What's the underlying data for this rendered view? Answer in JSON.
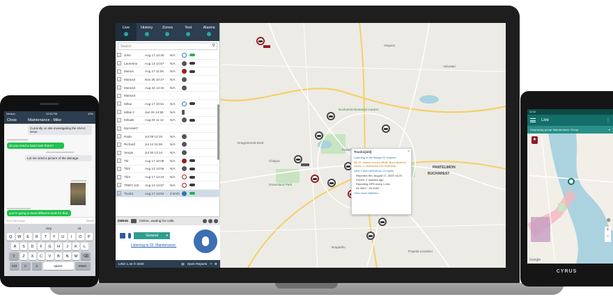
{
  "desktop": {
    "tabs": [
      {
        "label": "Live"
      },
      {
        "label": "History"
      },
      {
        "label": "Zones"
      },
      {
        "label": "Text"
      },
      {
        "label": "Alarms"
      }
    ],
    "search_placeholder": "Search",
    "vehicles": [
      {
        "name": "John",
        "date": "Aug 17 14:46",
        "speed": "N/A"
      },
      {
        "name": "Laurentiu",
        "date": "Aug 13 12:57",
        "speed": "N/A"
      },
      {
        "name": "Marius",
        "date": "Aug 17 11:06",
        "speed": "N/A"
      },
      {
        "name": "Marius2",
        "date": "Nov 26 10:27",
        "speed": "N/A"
      },
      {
        "name": "Marius3",
        "date": "Aug 22 14:16",
        "speed": "N/A"
      },
      {
        "name": "Marius4",
        "date": "",
        "speed": ""
      },
      {
        "name": "Mihai",
        "date": "Aug 17 10:51",
        "speed": "N/A"
      },
      {
        "name": "Mihai 2",
        "date": "Jan 26 14:56",
        "speed": "N/A"
      },
      {
        "name": "MihaiB",
        "date": "Aug 03 11:12",
        "speed": "N/A"
      },
      {
        "name": "MyAsset7",
        "date": "",
        "speed": ""
      },
      {
        "name": "Radu",
        "date": "Jul 09 12:10",
        "speed": "N/A"
      },
      {
        "name": "Richard",
        "date": "Jul 14 16:36",
        "speed": "N/A"
      },
      {
        "name": "Sergiu",
        "date": "Jul 30 13:14",
        "speed": "N/A"
      },
      {
        "name": "Tbl",
        "date": "Aug 17 10:08",
        "speed": "N/A"
      },
      {
        "name": "Tbl2",
        "date": "Aug 12 13:06",
        "speed": "N/A"
      },
      {
        "name": "Tbl4",
        "date": "Aug 17 14:23",
        "speed": "N/A"
      },
      {
        "name": "TRBO 115",
        "date": "Aug 14 14:57",
        "speed": "N/A"
      },
      {
        "name": "Truck1",
        "date": "Aug 17 14:52",
        "speed": "3 km/h"
      }
    ],
    "radio": {
      "device": "DB945",
      "status": "Online, waiting for calls.",
      "channel": "General",
      "listen": "Listening to 02. Maintenance."
    },
    "footer": {
      "version": "LINX 1.44 © 2020",
      "open_reports": "Open Reports"
    },
    "map": {
      "labels": [
        {
          "t": "Bucharest Botanical Garden",
          "cls": "park"
        },
        {
          "t": "Politehnica",
          "cls": ""
        },
        {
          "t": "Dreamland Park",
          "cls": "park"
        },
        {
          "t": "Dragomiresti-Deal",
          "cls": ""
        },
        {
          "t": "Chiajna",
          "cls": ""
        },
        {
          "t": "Bragadiru",
          "cls": ""
        },
        {
          "t": "Popesti-Leordeni",
          "cls": ""
        },
        {
          "t": "PANTELIMON",
          "cls": "city"
        },
        {
          "t": "BUCHAREST",
          "cls": "city"
        },
        {
          "t": "Voluntari",
          "cls": ""
        },
        {
          "t": "Otopeni",
          "cls": ""
        }
      ],
      "popup": {
        "title": "Truck1[4/3]",
        "listening": "Listening to the Bridge 22 channel",
        "address": "3B 25, strada Orzoiul 3B4B, Bulul Bellvern, Sector 4, Bucharest 041 Romania",
        "view_alert": "View 0 alert definitions (14 total)",
        "items": [
          "Reported Sth. August 17, 2020 14:23",
          "3 km/h, 2 minutes ago",
          "Reporting GPS every 1 min",
          "44.3901°, 26.1159°"
        ],
        "view_stats": "View route statistics"
      }
    }
  },
  "phone": {
    "status": {
      "carrier": "Verizon",
      "time": "12:33 PM",
      "battery": "43%"
    },
    "close": "Close",
    "title": "Maintenance - Mike",
    "messages": [
      {
        "dir": "in",
        "text": "Currently on site investigating the HVAC issue"
      },
      {
        "dir": "out",
        "text": "do you need a hand over there?"
      },
      {
        "dir": "in",
        "text": "Let me send a picture of the damage."
      },
      {
        "dir": "out",
        "text": "you're going to need different tools for that."
      }
    ],
    "input_placeholder": "Text Message",
    "send": "Send",
    "suggestions": [
      "I",
      "Hey",
      "Hi"
    ],
    "rows": [
      [
        "Q",
        "W",
        "E",
        "R",
        "T",
        "Y",
        "U",
        "I",
        "O",
        "P"
      ],
      [
        "A",
        "S",
        "D",
        "F",
        "G",
        "H",
        "J",
        "K",
        "L"
      ],
      [
        "Z",
        "X",
        "C",
        "V",
        "B",
        "N",
        "M"
      ]
    ],
    "key_123": "123",
    "key_space": "space",
    "key_return": "return"
  },
  "android": {
    "time": "12:10",
    "title": "Live",
    "group": "Displaying group Maintenance Group",
    "brand": "CYRUS",
    "google": "Google"
  },
  "colors": {
    "nav_dark": "#2c3e50",
    "accent_teal": "#28a8a0",
    "chat_green": "#21c14d",
    "android_bar": "#136e69"
  }
}
